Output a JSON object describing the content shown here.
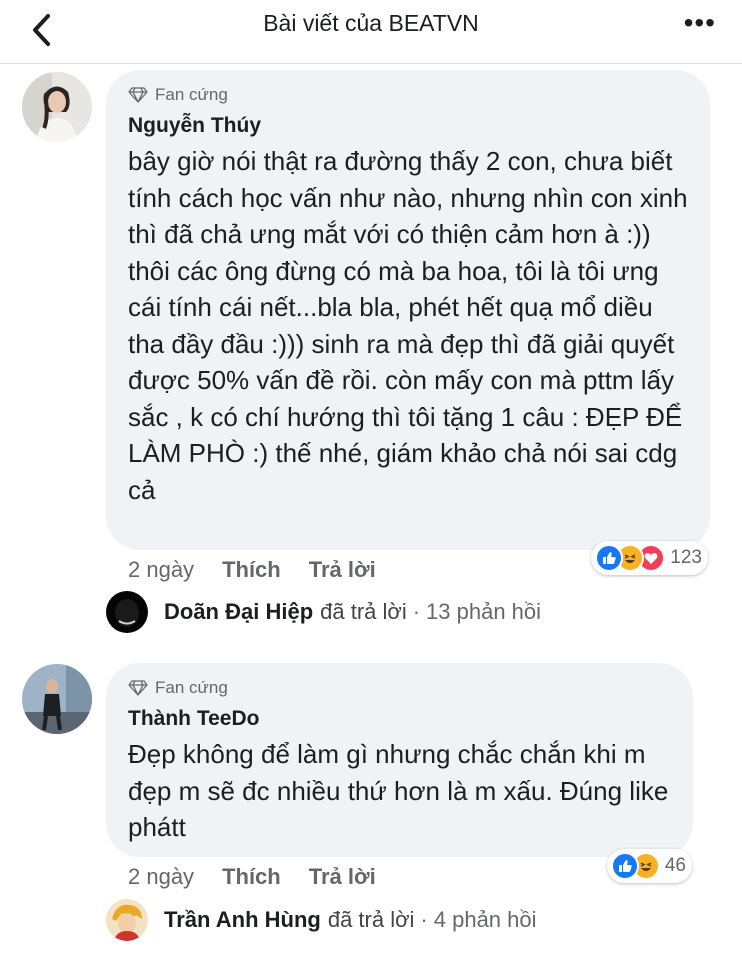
{
  "header": {
    "title": "Bài viết của BEATVN"
  },
  "comments": [
    {
      "badge": "Fan cứng",
      "author": "Nguyễn Thúy",
      "text": "bây giờ nói thật ra đường thấy 2 con, chưa biết tính cách học vấn như nào, nhưng nhìn con xinh thì đã chả ưng mắt với có thiện cảm hơn à :)) thôi các ông đừng có mà ba hoa, tôi là tôi ưng cái tính cái nết...bla bla, phét hết quạ mổ diều tha đầy đầu :))) sinh ra mà đẹp thì đã giải quyết được 50% vấn đề rồi. còn mấy con mà pttm lấy sắc , k có chí hướng thì tôi tặng 1 câu : ĐẸP ĐỂ LÀM PHÒ :) thế nhé, giám khảo chả nói sai cdg cả",
      "time": "2 ngày",
      "like": "Thích",
      "reply": "Trả lời",
      "reactions": [
        "like",
        "haha",
        "love"
      ],
      "reaction_count": "123",
      "reply_preview": {
        "name": "Doãn Đại Hiệp",
        "status": "đã trả lời",
        "count": "13 phản hồi"
      }
    },
    {
      "badge": "Fan cứng",
      "author": "Thành TeeDo",
      "text": "Đẹp không để làm gì nhưng chắc chắn khi m đẹp m sẽ đc nhiều thứ hơn là m xấu. Đúng like phátt",
      "time": "2 ngày",
      "like": "Thích",
      "reply": "Trả lời",
      "reactions": [
        "like",
        "haha"
      ],
      "reaction_count": "46",
      "reply_preview": {
        "name": "Trần Anh Hùng",
        "status": "đã trả lời",
        "count": "4 phản hồi"
      }
    }
  ],
  "colors": {
    "like": "#1877f2",
    "haha": "#f7b125",
    "love": "#f33e58",
    "bubble": "#f0f2f5",
    "meta": "#65676b"
  }
}
